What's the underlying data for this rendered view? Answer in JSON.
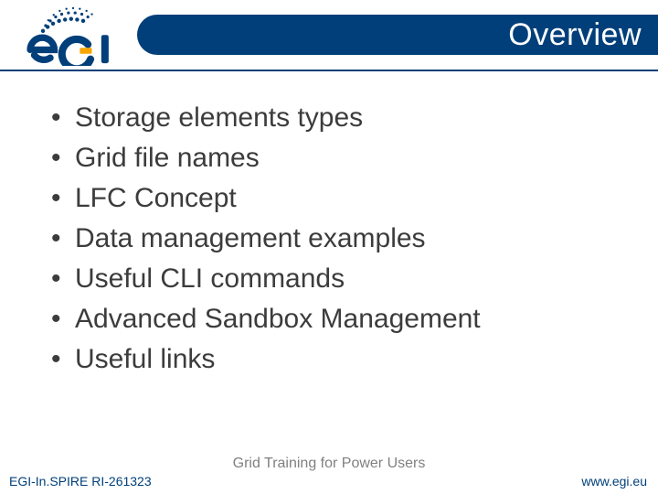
{
  "header": {
    "title": "Overview",
    "logo_name": "egi-logo"
  },
  "bullets": [
    "Storage elements types",
    "Grid file names",
    "LFC Concept",
    "Data management examples",
    "Useful CLI commands",
    "Advanced Sandbox Management",
    "Useful links"
  ],
  "footer": {
    "left": "EGI-In.SPIRE RI-261323",
    "center": "Grid Training for Power Users",
    "right": "www.egi.eu"
  },
  "colors": {
    "brand_blue": "#003f7a",
    "accent_gold": "#f7a600",
    "body_text": "#3c3c3c",
    "muted": "#808080"
  }
}
